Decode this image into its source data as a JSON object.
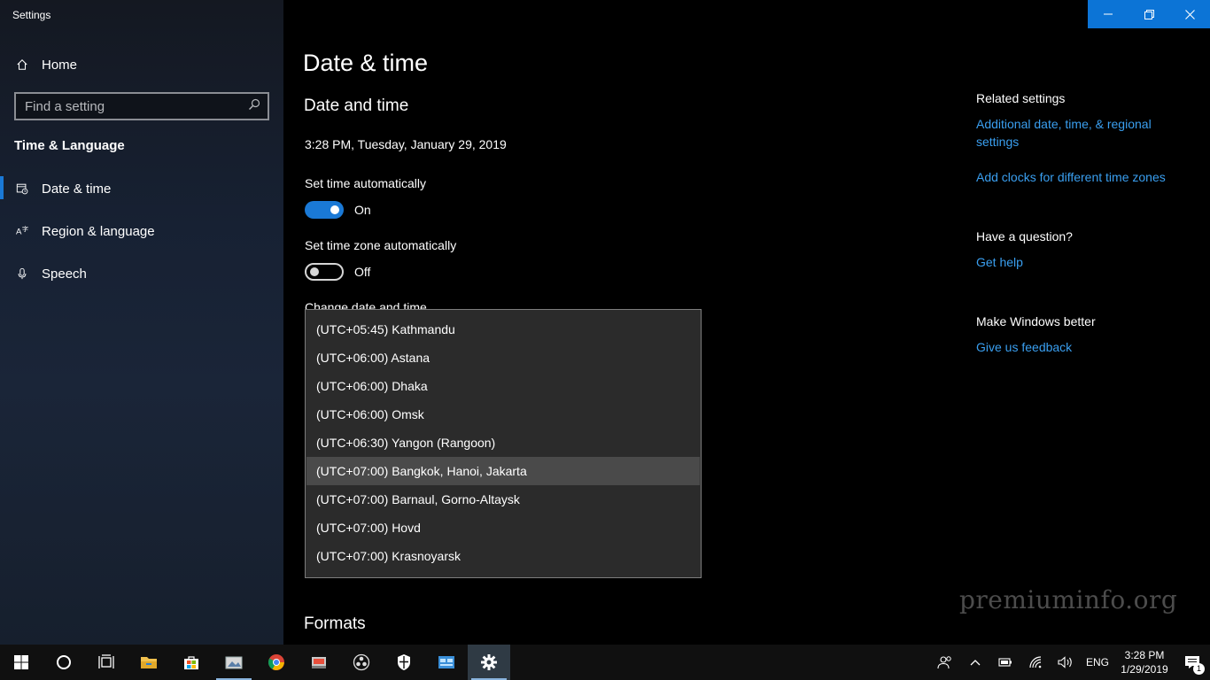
{
  "window": {
    "title": "Settings"
  },
  "sidebar": {
    "home_label": "Home",
    "search_placeholder": "Find a setting",
    "section": "Time & Language",
    "items": [
      {
        "label": "Date & time",
        "icon": "calendar-clock-icon",
        "active": true
      },
      {
        "label": "Region & language",
        "icon": "language-icon",
        "active": false
      },
      {
        "label": "Speech",
        "icon": "microphone-icon",
        "active": false
      }
    ]
  },
  "main": {
    "page_title": "Date & time",
    "subtitle": "Date and time",
    "current_time": "3:28 PM, Tuesday, January 29, 2019",
    "set_time_auto": {
      "label": "Set time automatically",
      "state": "On"
    },
    "set_zone_auto": {
      "label": "Set time zone automatically",
      "state": "Off"
    },
    "change_label": "Change date and time",
    "timezones": [
      "(UTC+05:45) Kathmandu",
      "(UTC+06:00) Astana",
      "(UTC+06:00) Dhaka",
      "(UTC+06:00) Omsk",
      "(UTC+06:30) Yangon (Rangoon)",
      "(UTC+07:00) Bangkok, Hanoi, Jakarta",
      "(UTC+07:00) Barnaul, Gorno-Altaysk",
      "(UTC+07:00) Hovd",
      "(UTC+07:00) Krasnoyarsk"
    ],
    "hovered_timezone": "(UTC+07:00) Bangkok, Hanoi, Jakarta",
    "formats": "Formats"
  },
  "related": {
    "heading": "Related settings",
    "link1": "Additional date, time, & regional settings",
    "link2": "Add clocks for different time zones",
    "question_heading": "Have a question?",
    "help_link": "Get help",
    "better_heading": "Make Windows better",
    "feedback_link": "Give us feedback"
  },
  "watermark": "premiuminfo.org",
  "taskbar": {
    "apps": [
      "start-icon",
      "cortana-icon",
      "task-view-icon",
      "file-explorer-icon",
      "store-icon",
      "photos-icon",
      "chrome-icon",
      "app-icon",
      "obs-icon",
      "security-icon",
      "control-panel-icon",
      "settings-icon"
    ],
    "language": "ENG",
    "time": "3:28 PM",
    "date": "1/29/2019",
    "notification_count": "1"
  },
  "colors": {
    "accent": "#1a79d6",
    "link": "#3a9ff0",
    "caption": "#0c74d6"
  }
}
